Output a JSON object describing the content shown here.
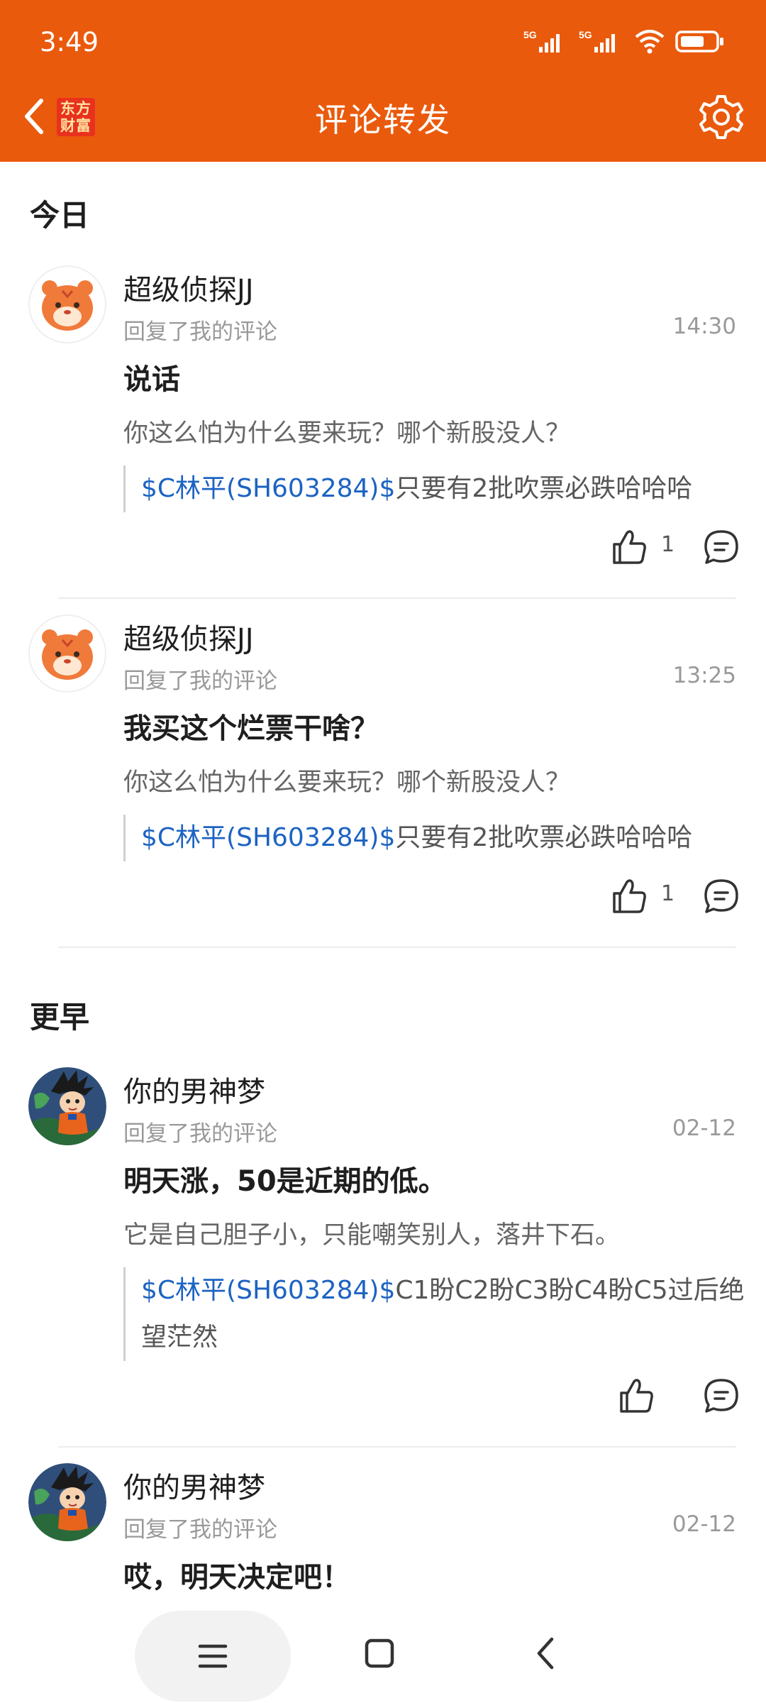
{
  "status_bar": {
    "time": "3:49",
    "net1": "5G",
    "net2": "5G"
  },
  "app_bar": {
    "logo_line1": "东方",
    "logo_line2": "财富",
    "title": "评论转发"
  },
  "sections": {
    "today": "今日",
    "earlier": "更早"
  },
  "items": [
    {
      "name": "超级侦探JJ",
      "subtitle": "回复了我的评论",
      "time": "14:30",
      "title": "说话",
      "reply": "你这么怕为什么要来玩？哪个新股没人？",
      "quote_link": "$C林平(SH603284)$",
      "quote_text": "只要有2批吹票必跌哈哈哈",
      "likes": "1"
    },
    {
      "name": "超级侦探JJ",
      "subtitle": "回复了我的评论",
      "time": "13:25",
      "title": "我买这个烂票干啥？",
      "reply": "你这么怕为什么要来玩？哪个新股没人？",
      "quote_link": "$C林平(SH603284)$",
      "quote_text": "只要有2批吹票必跌哈哈哈",
      "likes": "1"
    },
    {
      "name": "你的男神梦",
      "subtitle": "回复了我的评论",
      "time": "02-12",
      "title": "明天涨，50是近期的低。",
      "reply": "它是自己胆子小，只能嘲笑别人，落井下石。",
      "quote_link": "$C林平(SH603284)$",
      "quote_text": "C1盼C2盼C3盼C4盼C5过后绝望茫然"
    },
    {
      "name": "你的男神梦",
      "subtitle": "回复了我的评论",
      "time": "02-12",
      "title": "哎，明天决定吧！"
    }
  ],
  "colors": {
    "accent": "#ea5a0c",
    "link": "#1c63c2",
    "muted": "#999999"
  },
  "icons": {
    "back": "chevron-left-icon",
    "settings": "gear-icon",
    "like": "thumbs-up-icon",
    "comment": "comment-bubble-icon",
    "nav_menu": "menu-icon",
    "nav_home": "square-icon",
    "nav_back": "chevron-left-icon"
  }
}
